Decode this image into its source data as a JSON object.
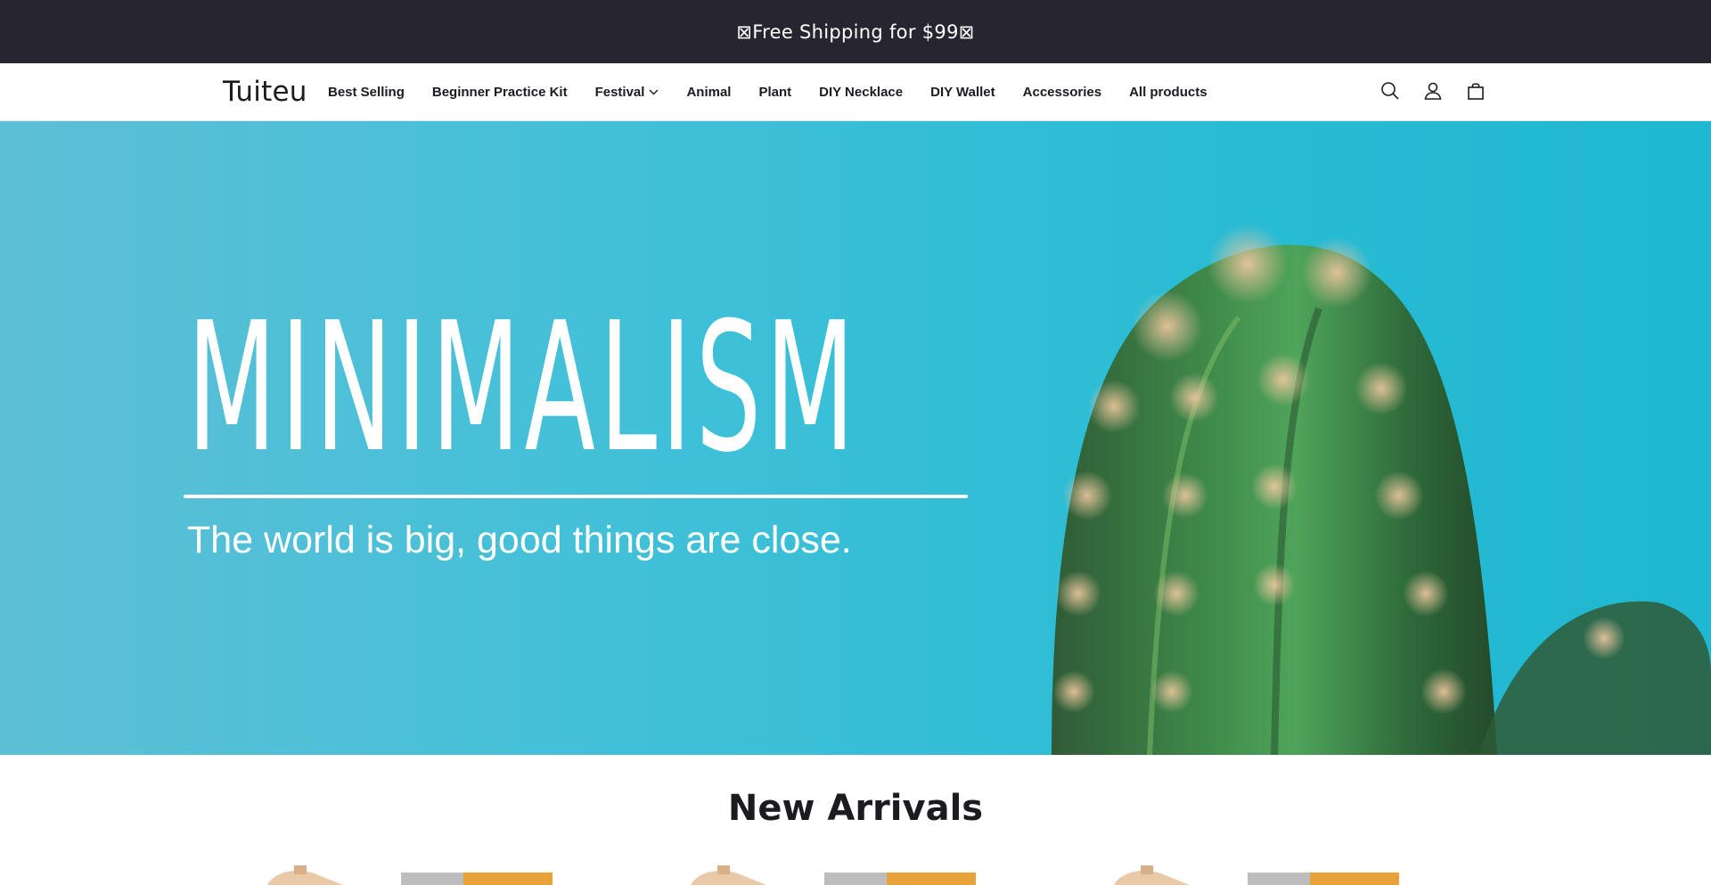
{
  "announcement": {
    "text": "⊠Free Shipping for $99⊠"
  },
  "header": {
    "logo": "Tuiteu",
    "nav": [
      {
        "label": "Best Selling"
      },
      {
        "label": "Beginner Practice Kit"
      },
      {
        "label": "Festival",
        "has_dropdown": true
      },
      {
        "label": "Animal"
      },
      {
        "label": "Plant"
      },
      {
        "label": "DIY Necklace"
      },
      {
        "label": "DIY Wallet"
      },
      {
        "label": "Accessories"
      },
      {
        "label": "All products"
      }
    ],
    "icons": [
      "search-icon",
      "account-icon",
      "cart-icon"
    ]
  },
  "hero": {
    "title": "MINIMALISM",
    "subtitle": "The world is big, good things are close.",
    "background_color": "#29bcd4"
  },
  "new_arrivals": {
    "title": "New Arrivals"
  },
  "colors": {
    "announcement_bg": "#27252f",
    "text": "#1c1b22",
    "hero_bg": "#29bcd4"
  }
}
